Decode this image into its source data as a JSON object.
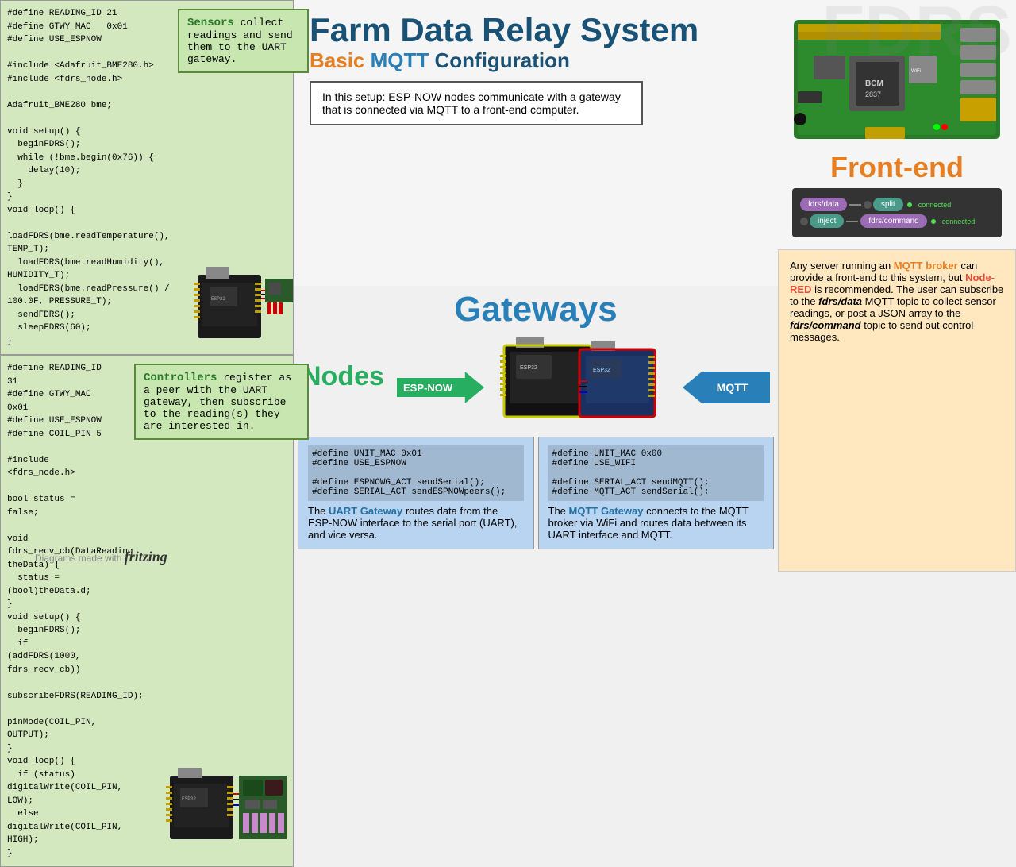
{
  "page": {
    "title": "Farm Data Relay System - Basic MQTT Configuration",
    "subtitle_basic": "Basic",
    "subtitle_mqtt": "MQTT",
    "subtitle_config": "Configuration"
  },
  "header": {
    "title_part1": "Farm Data Relay System",
    "title_part2": "Basic",
    "title_part3": " MQTT ",
    "title_part4": "Configuration"
  },
  "info_box": {
    "text": "In this setup: ESP-NOW nodes communicate with a gateway that is connected via MQTT to a front-end computer."
  },
  "sensors": {
    "description_keyword": "Sensors",
    "description": " collect readings and send them to the UART gateway.",
    "code": "#define READING_ID 21\n#define GTWY_MAC   0x01\n#define USE_ESPNOW\n\n#include <Adafruit_BME280.h>\n#include <fdrs_node.h>\n\nAdafruit_BME280 bme;\n\nvoid setup() {\n  beginFDRS();\n  while (!bme.begin(0x76)) {\n    delay(10);\n  }\n}\nvoid loop() {\n  loadFDRS(bme.readTemperature(), TEMP_T);\n  loadFDRS(bme.readHumidity(), HUMIDITY_T);\n  loadFDRS(bme.readPressure() / 100.0F, PRESSURE_T);\n  sendFDRS();\n  sleepFDRS(60);\n}"
  },
  "controllers": {
    "description_keyword": "Controllers",
    "description": " register as a peer with the UART gateway, then subscribe to the reading(s) they are interested in.",
    "code": "#define READING_ID 31\n#define GTWY_MAC 0x01\n#define USE_ESPNOW\n#define COIL_PIN 5\n\n#include <fdrs_node.h>\n\nbool status = false;\n\nvoid fdrs_recv_cb(DataReading theData) {\n  status = (bool)theData.d;\n}\n\nvoid setup() {\n  beginFDRS();\n  if (addFDRS(1000, fdrs_recv_cb))\n    subscribeFDRS(READING_ID);\n  pinMode(COIL_PIN, OUTPUT);\n}\nvoid loop() {\n  if (status) digitalWrite(COIL_PIN, LOW);\n  else digitalWrite(COIL_PIN, HIGH);\n}"
  },
  "gateways": {
    "title": "Gateways",
    "nodes_label": "Nodes",
    "espnow_arrow": "ESP-NOW",
    "mqtt_arrow": "MQTT",
    "uart_box": {
      "title": "UART Gateway",
      "description": "routes data from the ESP-NOW interface to the serial port (UART), and vice versa.",
      "code_line1": "#define UNIT_MAC    0x01",
      "code_line2": "#define USE_ESPNOW",
      "code_line3": "",
      "code_line4": "#define ESPNOWG_ACT sendSerial();",
      "code_line5": "#define SERIAL_ACT  sendESPNOWpeers();"
    },
    "mqtt_gw_box": {
      "title": "MQTT Gateway",
      "description": "connects to the MQTT broker via WiFi and routes data between its UART interface and MQTT.",
      "code_line1": "#define UNIT_MAC    0x00",
      "code_line2": "#define USE_WIFI",
      "code_line3": "",
      "code_line4": "#define SERIAL_ACT  sendMQTT();",
      "code_line5": "#define MQTT_ACT    sendSerial();"
    }
  },
  "frontend": {
    "label": "Front-end",
    "nodered_flow": {
      "row1_node1": "fdrs/data",
      "row1_node2": "split",
      "row1_connected": "connected",
      "row2_node1": "inject",
      "row2_node2": "fdrs/command",
      "row2_connected": "connected"
    },
    "description": "Any server running an ",
    "mqtt_keyword": "MQTT broker",
    "desc2": " can provide a front-end to this system, but ",
    "nodered_keyword": "Node-RED",
    "desc3": " is recommended. The user can subscribe to the ",
    "topic1": "fdrs/data",
    "desc4": " MQTT topic to collect sensor readings, or post a JSON array to the ",
    "topic2": "fdrs/command",
    "desc5": " topic to send out control messages."
  },
  "footer": {
    "made_with": "Diagrams made with",
    "brand": "fritzing"
  },
  "fdrs_logo": "FDRS"
}
